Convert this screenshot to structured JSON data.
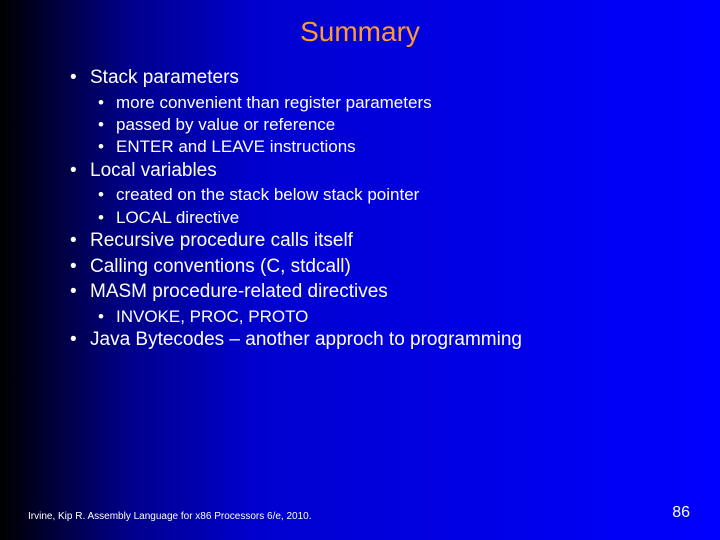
{
  "title": "Summary",
  "bullets": {
    "b0": "Stack parameters",
    "b0s0": "more convenient than register parameters",
    "b0s1": "passed by value or reference",
    "b0s2": "ENTER and LEAVE instructions",
    "b1": "Local variables",
    "b1s0": "created on the stack below stack pointer",
    "b1s1": "LOCAL directive",
    "b2": "Recursive procedure calls itself",
    "b3": "Calling conventions (C, stdcall)",
    "b4": "MASM procedure-related directives",
    "b4s0": "INVOKE, PROC, PROTO",
    "b5": "Java Bytecodes – another approch to programming"
  },
  "footer": "Irvine, Kip R. Assembly Language for x86 Processors 6/e, 2010.",
  "page": "86"
}
